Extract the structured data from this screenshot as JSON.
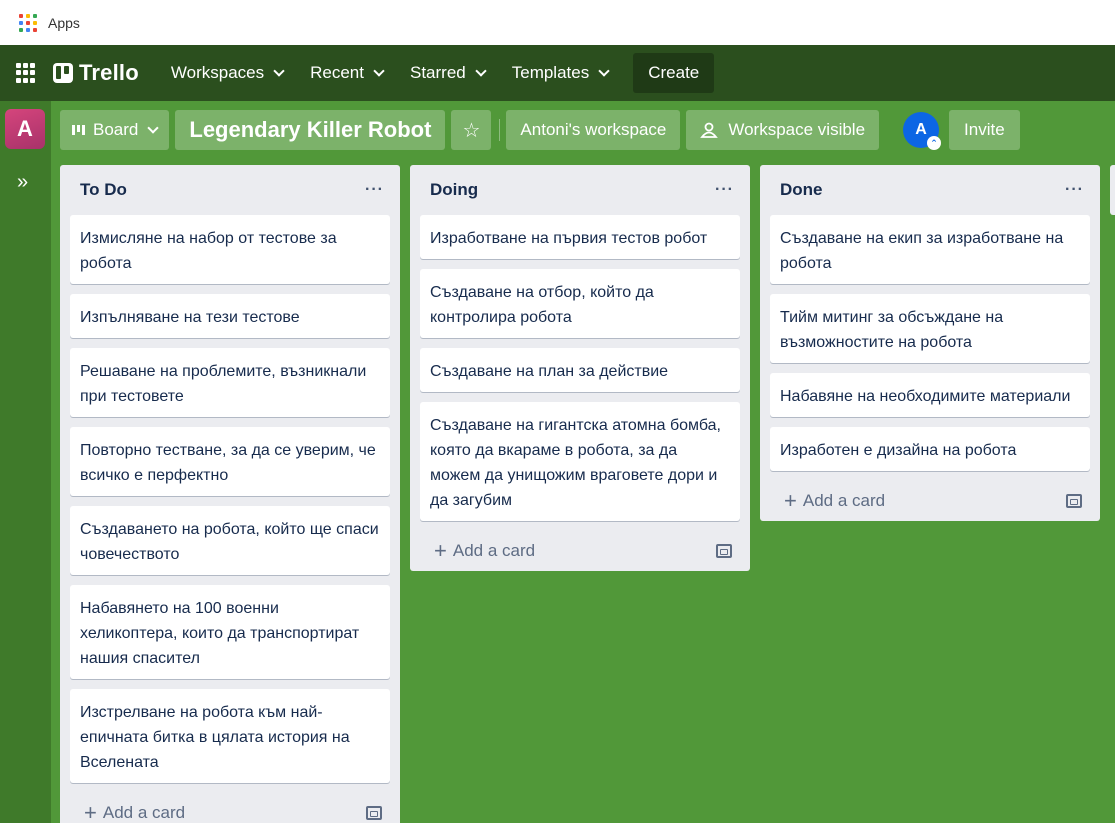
{
  "browser": {
    "apps_label": "Apps",
    "apps_grid_colors": [
      "#ea4335",
      "#fbbc05",
      "#34a853",
      "#4285f4",
      "#ea4335",
      "#fbbc05",
      "#34a853",
      "#4285f4",
      "#ea4335"
    ]
  },
  "header": {
    "switcher_icon": "app-switcher-icon",
    "logo_text": "Trello",
    "nav": [
      {
        "label": "Workspaces"
      },
      {
        "label": "Recent"
      },
      {
        "label": "Starred"
      },
      {
        "label": "Templates"
      }
    ],
    "create_label": "Create"
  },
  "sidebar": {
    "workspace_initial": "A",
    "expand_icon": "»"
  },
  "board_header": {
    "view_label": "Board",
    "title": "Legendary Killer Robot",
    "star_icon": "☆",
    "workspace_label": "Antoni's workspace",
    "visibility_label": "Workspace visible",
    "user_initial": "A",
    "invite_label": "Invite"
  },
  "lists": [
    {
      "title": "To Do",
      "add_card_label": "Add a card",
      "cards": [
        "Измисляне на набор от тестове за робота",
        "Изпълняване на тези тестове",
        "Решаване на проблемите, възникнали при тестовете",
        "Повторно тестване, за да се уверим, че всичко е перфектно",
        "Създаването на робота, който ще спаси човечеството",
        "Набавянето на 100 военни хеликоптера, които да транспортират нашия спасител",
        "Изстрелване на робота към най-епичната битка в цялата история на Вселената"
      ]
    },
    {
      "title": "Doing",
      "add_card_label": "Add a card",
      "cards": [
        "Изработване на първия тестов робот",
        "Създаване на отбор, който да контролира робота",
        "Създаване на план за действие",
        "Създаване на гигантска атомна бомба, която да вкараме в робота, за да можем да унищожим враговете дори и да загубим"
      ]
    },
    {
      "title": "Done",
      "add_card_label": "Add a card",
      "cards": [
        "Създаване на екип за изработване на робота",
        "Тийм митинг за обсъждане на възможностите на робота",
        "Набавяне на необходимите материали",
        "Изработен е дизайна на робота"
      ]
    }
  ],
  "colors": {
    "board_bg": "#519839",
    "header_bg": "#2b4f1e",
    "list_bg": "#ebecf0",
    "workspace_badge": "#c93c76",
    "user_avatar": "#0c66e4"
  }
}
